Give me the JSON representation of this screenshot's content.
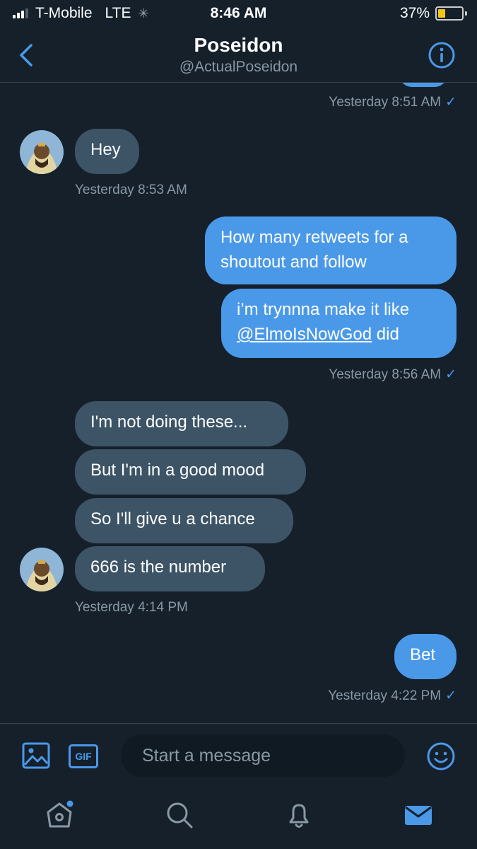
{
  "status": {
    "carrier": "T-Mobile",
    "network": "LTE",
    "time": "8:46 AM",
    "battery": "37%",
    "battery_level": 0.37
  },
  "header": {
    "title": "Poseidon",
    "handle": "@ActualPoseidon"
  },
  "thread": {
    "stamp_1": "Yesterday 8:51 AM",
    "msg_hey": "Hey",
    "stamp_2": "Yesterday 8:53 AM",
    "msg_out_1": "How many retweets for a shoutout and follow",
    "msg_out_2_pre": "i’m trynnna make it like ",
    "msg_out_2_mention": "@ElmoIsNowGod",
    "msg_out_2_post": " did",
    "stamp_3": "Yesterday 8:56 AM",
    "msg_in_1": "I'm not doing these...",
    "msg_in_2": "But I'm in a good mood",
    "msg_in_3": "So I'll give u a chance",
    "msg_in_4": "666 is the number",
    "stamp_4": "Yesterday 4:14 PM",
    "msg_bet": "Bet",
    "stamp_5": "Yesterday 4:22 PM",
    "check": "✓"
  },
  "composer": {
    "gif_label": "GIF",
    "placeholder": "Start a message"
  },
  "colors": {
    "background": "#15202b",
    "accent": "#4a99e9",
    "incoming_bubble": "#3d5466",
    "muted_text": "#8899a6"
  }
}
